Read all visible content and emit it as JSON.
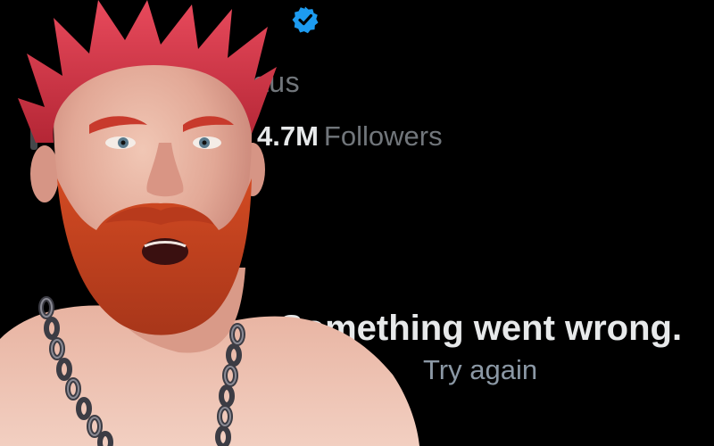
{
  "profile": {
    "handle_fragment": "aus",
    "followers_count": "4.7M",
    "followers_label": "Followers",
    "verified": true
  },
  "error": {
    "title": "Something went wrong.",
    "retry_label": "Try again"
  },
  "colors": {
    "background": "#000000",
    "primary_text": "#e7e9ea",
    "secondary_text": "#71767b",
    "verified_blue": "#1d9bf0",
    "hair_red": "#d8343f",
    "beard_orange": "#c2401e"
  }
}
